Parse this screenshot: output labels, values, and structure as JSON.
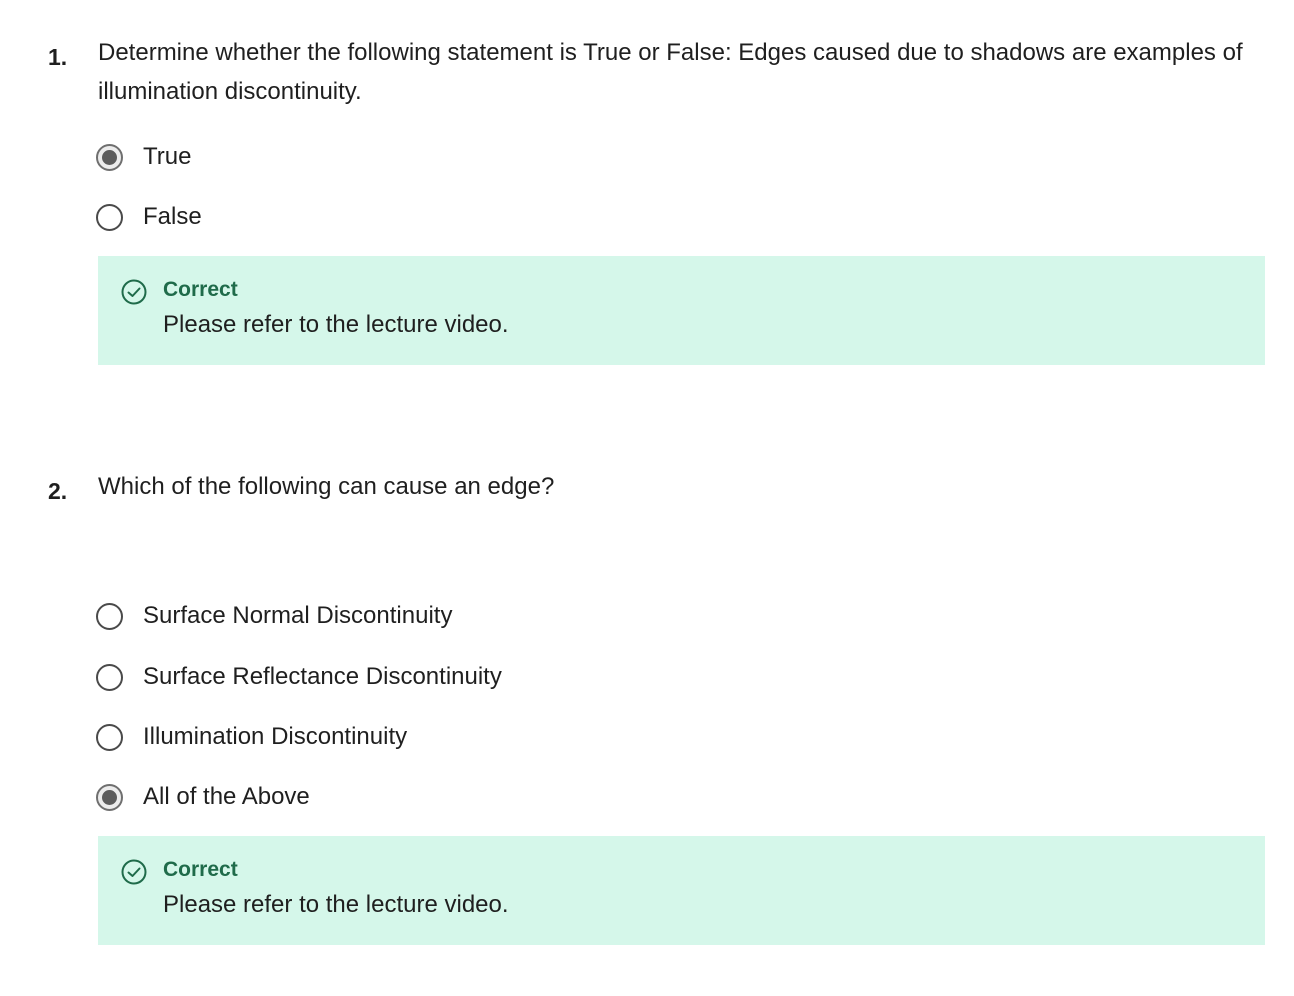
{
  "questions": [
    {
      "number": "1.",
      "text": "Determine whether the following statement is True or False: Edges caused due to shadows are examples of illumination discontinuity.",
      "options": [
        {
          "label": "True",
          "selected": true
        },
        {
          "label": "False",
          "selected": false
        }
      ],
      "feedback": {
        "status": "Correct",
        "message": "Please refer to the lecture video."
      }
    },
    {
      "number": "2.",
      "text": "Which of the following can cause an edge?",
      "options": [
        {
          "label": "Surface Normal Discontinuity",
          "selected": false
        },
        {
          "label": "Surface Reflectance Discontinuity",
          "selected": false
        },
        {
          "label": "Illumination Discontinuity",
          "selected": false
        },
        {
          "label": "All of the Above",
          "selected": true
        }
      ],
      "feedback": {
        "status": "Correct",
        "message": "Please refer to the lecture video."
      }
    }
  ],
  "colors": {
    "feedback_background": "#d5f7ea",
    "correct_accent": "#1f6b4a"
  },
  "icons": {
    "feedback_icon": "check-circle-icon"
  }
}
